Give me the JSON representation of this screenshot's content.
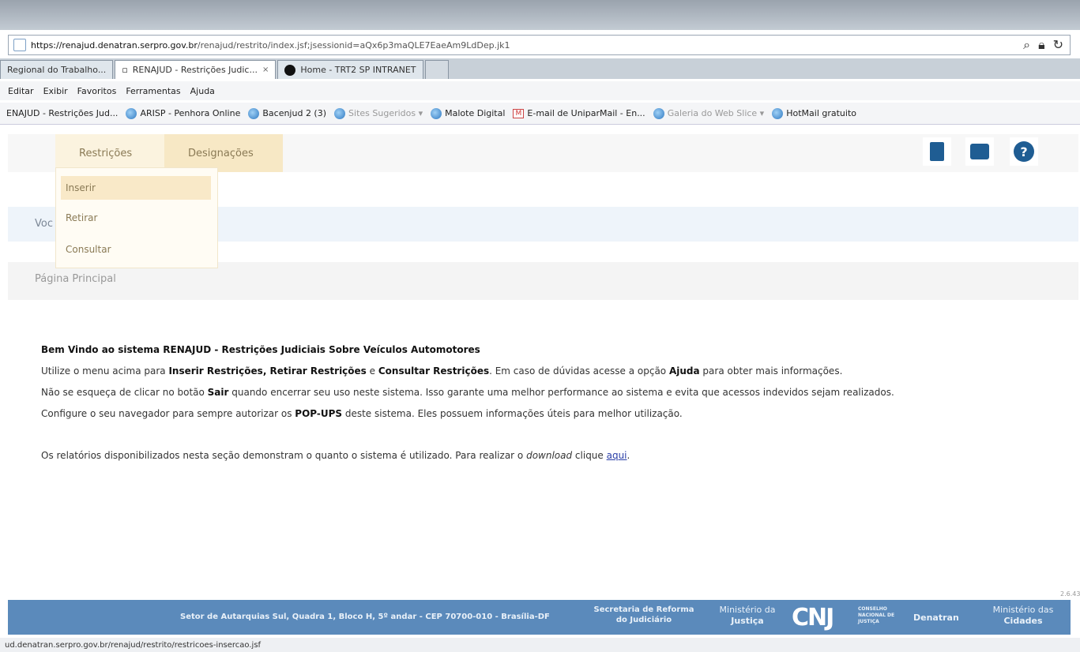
{
  "browser": {
    "url_host": "https://renajud.denatran.serpro.gov.br",
    "url_rest": "/renajud/restrito/index.jsf;jsessionid=aQx6p3maQLE7EaeAm9LdDep.jk1",
    "tabs": [
      {
        "label": "Regional do Trabalho...",
        "active": false
      },
      {
        "label": "RENAJUD - Restrições Judic...",
        "active": true,
        "close": "×"
      },
      {
        "label": "Home - TRT2 SP INTRANET",
        "active": false
      }
    ],
    "menu": [
      "Editar",
      "Exibir",
      "Favoritos",
      "Ferramentas",
      "Ajuda"
    ],
    "favorites": [
      {
        "label": "ENAJUD - Restrições Jud...",
        "icon": "none"
      },
      {
        "label": "ARISP - Penhora Online",
        "icon": "ie"
      },
      {
        "label": "Bacenjud 2 (3)",
        "icon": "ie"
      },
      {
        "label": "Sites Sugeridos ▾",
        "icon": "ie",
        "dim": true
      },
      {
        "label": "Malote Digital",
        "icon": "ie"
      },
      {
        "label": "E-mail de UniparMail - En...",
        "icon": "gmail"
      },
      {
        "label": "Galeria do Web Slice ▾",
        "icon": "ie",
        "dim": true
      },
      {
        "label": "HotMail gratuito",
        "icon": "ie"
      }
    ],
    "status_url": "ud.denatran.serpro.gov.br/renajud/restrito/restricoes-insercao.jsf"
  },
  "nav": {
    "restricoes": "Restrições",
    "designacoes": "Designações",
    "dropdown": [
      "Inserir",
      "Retirar",
      "Consultar"
    ]
  },
  "bands": {
    "welcome": "Voc",
    "crumb": "Página Principal"
  },
  "content": {
    "heading": "Bem Vindo ao sistema RENAJUD - Restrições Judiciais Sobre Veículos Automotores",
    "p1_a": "Utilize o menu acima para ",
    "p1_b": "Inserir Restrições, Retirar Restrições",
    "p1_c": " e ",
    "p1_d": "Consultar Restrições",
    "p1_e": ". Em caso de dúvidas acesse a opção ",
    "p1_f": "Ajuda",
    "p1_g": " para obter mais informações.",
    "p2_a": "Não se esqueça de clicar no botão ",
    "p2_b": "Sair",
    "p2_c": " quando encerrar seu uso neste sistema. Isso garante uma melhor performance ao sistema e evita que acessos indevidos sejam realizados.",
    "p3_a": "Configure o seu navegador para sempre autorizar os ",
    "p3_b": "POP-UPS",
    "p3_c": " deste sistema. Eles possuem informações úteis para melhor utilização.",
    "p4_a": "Os relatórios disponibilizados nesta seção demonstram o quanto o sistema é utilizado. Para realizar o ",
    "p4_b": "download",
    "p4_c": " clique ",
    "p4_link": "aqui",
    "p4_d": "."
  },
  "version": "2.6.43",
  "footer": {
    "address": "Setor de Autarquias Sul, Quadra 1, Bloco H, 5º andar - CEP 70700-010 - Brasília-DF",
    "secretaria": "Secretaria de Reforma do Judiciário",
    "ministerio_justica_1": "Ministério da",
    "ministerio_justica_2": "Justiça",
    "cnj": "CNJ",
    "cnj_sub": "CONSELHO NACIONAL DE JUSTIÇA",
    "denatran": "Denatran",
    "ministerio_cidades_1": "Ministério das",
    "ministerio_cidades_2": "Cidades"
  }
}
